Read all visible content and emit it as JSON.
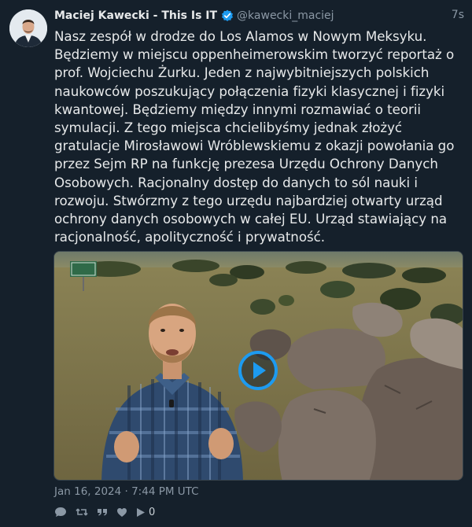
{
  "tweet": {
    "author": {
      "display_name": "Maciej Kawecki - This Is IT",
      "handle": "@kawecki_maciej",
      "verified": true
    },
    "relative_time": "7s",
    "text": "Nasz zespół w drodze do Los Alamos w Nowym Meksyku. Będziemy w miejscu oppenheimerowskim tworzyć reportaż o prof. Wojciechu Żurku. Jeden z najwybitniejszych polskich naukowców poszukujący połączenia fizyki klasycznej i fizyki kwantowej. Będziemy między innymi rozmawiać o teorii symulacji. Z tego miejsca chcielibyśmy jednak złożyć gratulacje Mirosławowi Wróblewskiemu z okazji powołania go przez Sejm RP na funkcję prezesa Urzędu Ochrony Danych Osobowych. Racjonalny dostęp do danych to sól nauki i rozwoju. Stwórzmy z tego urzędu najbardziej otwarty urząd ochrony danych osobowych w całej EU. Urząd stawiający na racjonalność, apolityczność i prywatność.",
    "timestamp": "Jan 16, 2024 · 7:44 PM UTC",
    "media": {
      "type": "video",
      "icon": "play-icon"
    },
    "actions": {
      "views_count": "0"
    }
  },
  "colors": {
    "background": "#15202b",
    "text": "#e7e9ea",
    "muted": "#8b98a5",
    "accent": "#1d9bf0"
  }
}
